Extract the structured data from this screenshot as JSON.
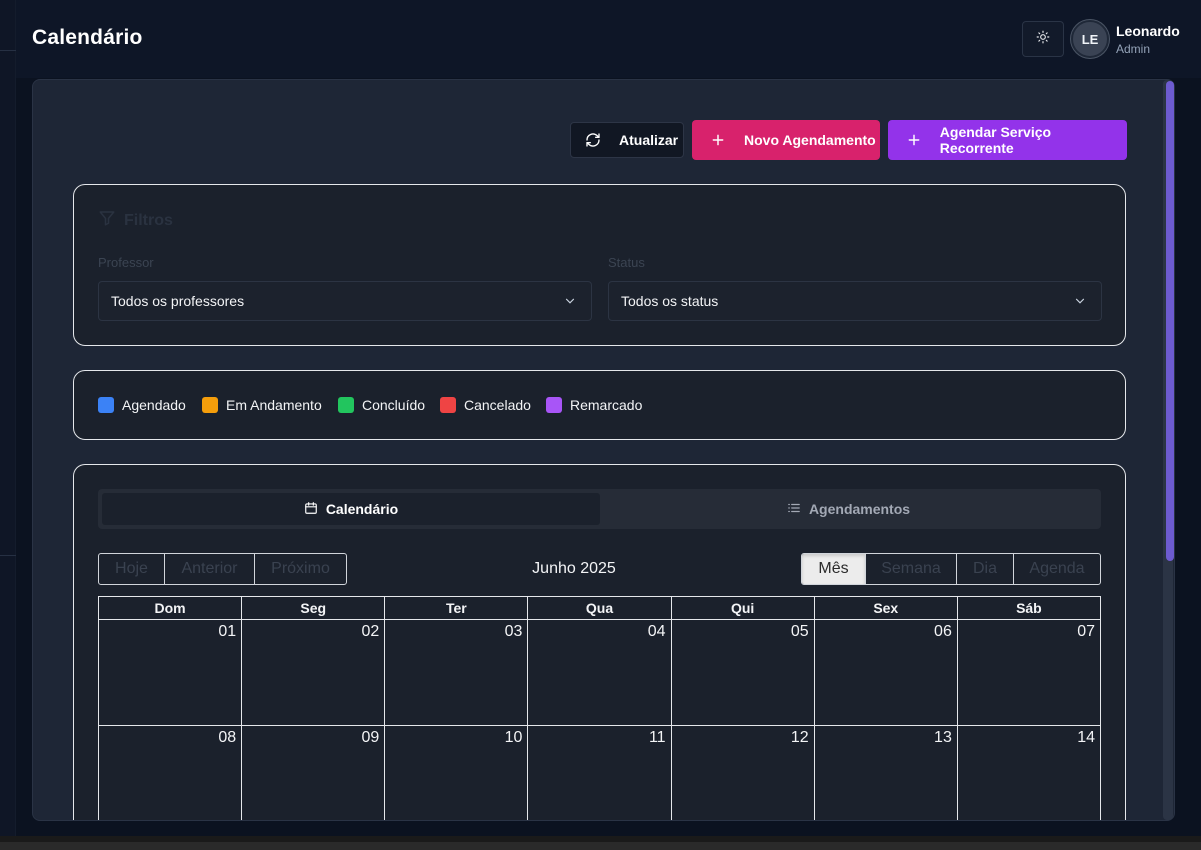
{
  "header": {
    "title": "Calendário",
    "user": {
      "initials": "LE",
      "name": "Leonardo",
      "role": "Admin"
    }
  },
  "actions": {
    "refresh": "Atualizar",
    "new_appointment": "Novo Agendamento",
    "recurring": "Agendar Serviço Recorrente"
  },
  "filters": {
    "title": "Filtros",
    "professor_label": "Professor",
    "professor_value": "Todos os professores",
    "status_label": "Status",
    "status_value": "Todos os status"
  },
  "legend": [
    {
      "label": "Agendado",
      "color": "#3b82f6"
    },
    {
      "label": "Em Andamento",
      "color": "#f59e0b"
    },
    {
      "label": "Concluído",
      "color": "#22c55e"
    },
    {
      "label": "Cancelado",
      "color": "#ef4444"
    },
    {
      "label": "Remarcado",
      "color": "#a855f7"
    }
  ],
  "tabs": {
    "calendar": "Calendário",
    "appointments": "Agendamentos"
  },
  "calendar": {
    "nav": {
      "today": "Hoje",
      "prev": "Anterior",
      "next": "Próximo"
    },
    "month_label": "Junho 2025",
    "views": {
      "month": "Mês",
      "week": "Semana",
      "day": "Dia",
      "agenda": "Agenda"
    },
    "weekdays": [
      "Dom",
      "Seg",
      "Ter",
      "Qua",
      "Qui",
      "Sex",
      "Sáb"
    ],
    "weeks": [
      [
        "01",
        "02",
        "03",
        "04",
        "05",
        "06",
        "07"
      ],
      [
        "08",
        "09",
        "10",
        "11",
        "12",
        "13",
        "14"
      ]
    ]
  }
}
